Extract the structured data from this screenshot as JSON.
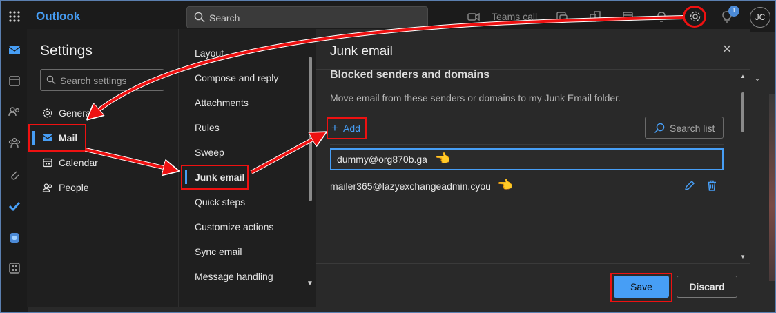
{
  "app": {
    "name": "Outlook"
  },
  "search": {
    "placeholder": "Search"
  },
  "topbar": {
    "teams_call": "Teams call",
    "notification_count": "1",
    "avatar_initials": "JC"
  },
  "settings": {
    "title": "Settings",
    "search_placeholder": "Search settings",
    "nav": [
      {
        "label": "General",
        "icon": "gear-icon"
      },
      {
        "label": "Mail",
        "icon": "mail-icon"
      },
      {
        "label": "Calendar",
        "icon": "calendar-icon"
      },
      {
        "label": "People",
        "icon": "people-icon"
      }
    ],
    "mail_nav": [
      "Layout",
      "Compose and reply",
      "Attachments",
      "Rules",
      "Sweep",
      "Junk email",
      "Quick steps",
      "Customize actions",
      "Sync email",
      "Message handling"
    ]
  },
  "junk": {
    "title": "Junk email",
    "section_title": "Blocked senders and domains",
    "description": "Move email from these senders or domains to my Junk Email folder.",
    "add_label": "Add",
    "search_list_label": "Search list",
    "input_value": "dummy@org870b.ga",
    "senders": [
      "mailer365@lazyexchangeadmin.cyou"
    ]
  },
  "footer": {
    "save_label": "Save",
    "discard_label": "Discard"
  },
  "colors": {
    "accent": "#479ef5",
    "highlight": "#ee1111",
    "background": "#1f1f1f"
  }
}
